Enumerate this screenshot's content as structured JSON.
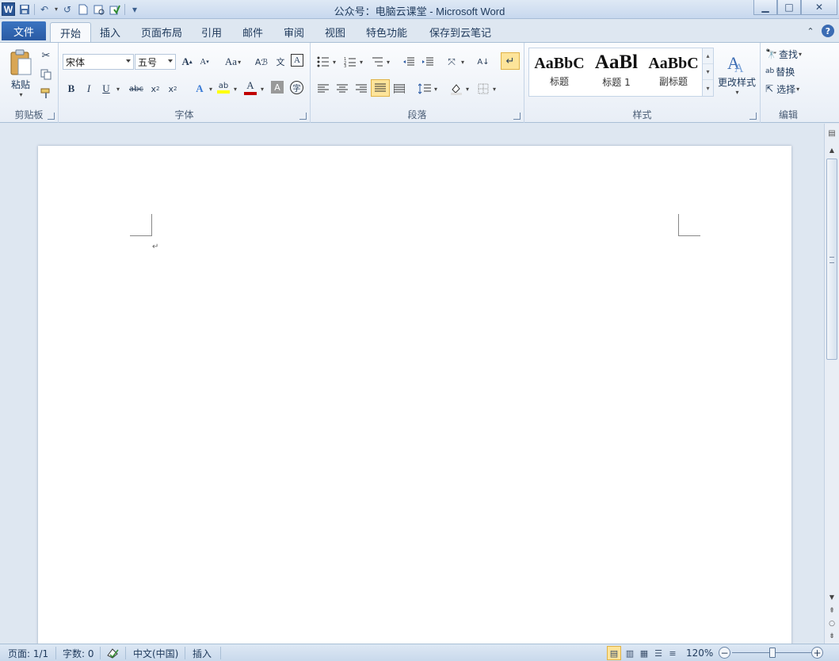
{
  "window": {
    "title": "公众号：电脑云课堂 - Microsoft Word",
    "app_icon": "W",
    "controls": {
      "minimize": "▁",
      "maximize": "□",
      "close": "✕"
    }
  },
  "quick_access": [
    "save-icon",
    "undo-icon",
    "redo-icon",
    "new-icon",
    "print-preview-icon",
    "spelling-icon",
    "customize-icon"
  ],
  "tabs": {
    "file": "文件",
    "items": [
      "开始",
      "插入",
      "页面布局",
      "引用",
      "邮件",
      "审阅",
      "视图",
      "特色功能",
      "保存到云笔记"
    ],
    "active": "开始"
  },
  "ribbon": {
    "clipboard": {
      "label": "剪贴板",
      "paste": "粘贴"
    },
    "font": {
      "label": "字体",
      "font_name": "宋体",
      "font_size": "五号",
      "change_case": "Aa"
    },
    "paragraph": {
      "label": "段落"
    },
    "styles": {
      "label": "样式",
      "items": [
        {
          "sample": "AaBbC",
          "name": "标题"
        },
        {
          "sample": "AaBl",
          "name": "标题 1"
        },
        {
          "sample": "AaBbC",
          "name": "副标题"
        }
      ],
      "change_styles": "更改样式"
    },
    "editing": {
      "label": "编辑",
      "find": "查找",
      "replace": "替换",
      "select": "选择"
    }
  },
  "document": {
    "paragraph_mark": "↵"
  },
  "statusbar": {
    "page": "页面: 1/1",
    "words": "字数: 0",
    "language": "中文(中国)",
    "mode": "插入",
    "zoom": "120%"
  },
  "colors": {
    "accent": "#2b5797",
    "file_tab": "#2a5aa3",
    "highlight_active": "#fde49a",
    "font_color_bar": "#c00000",
    "highlight_color_bar": "#ffff00"
  }
}
